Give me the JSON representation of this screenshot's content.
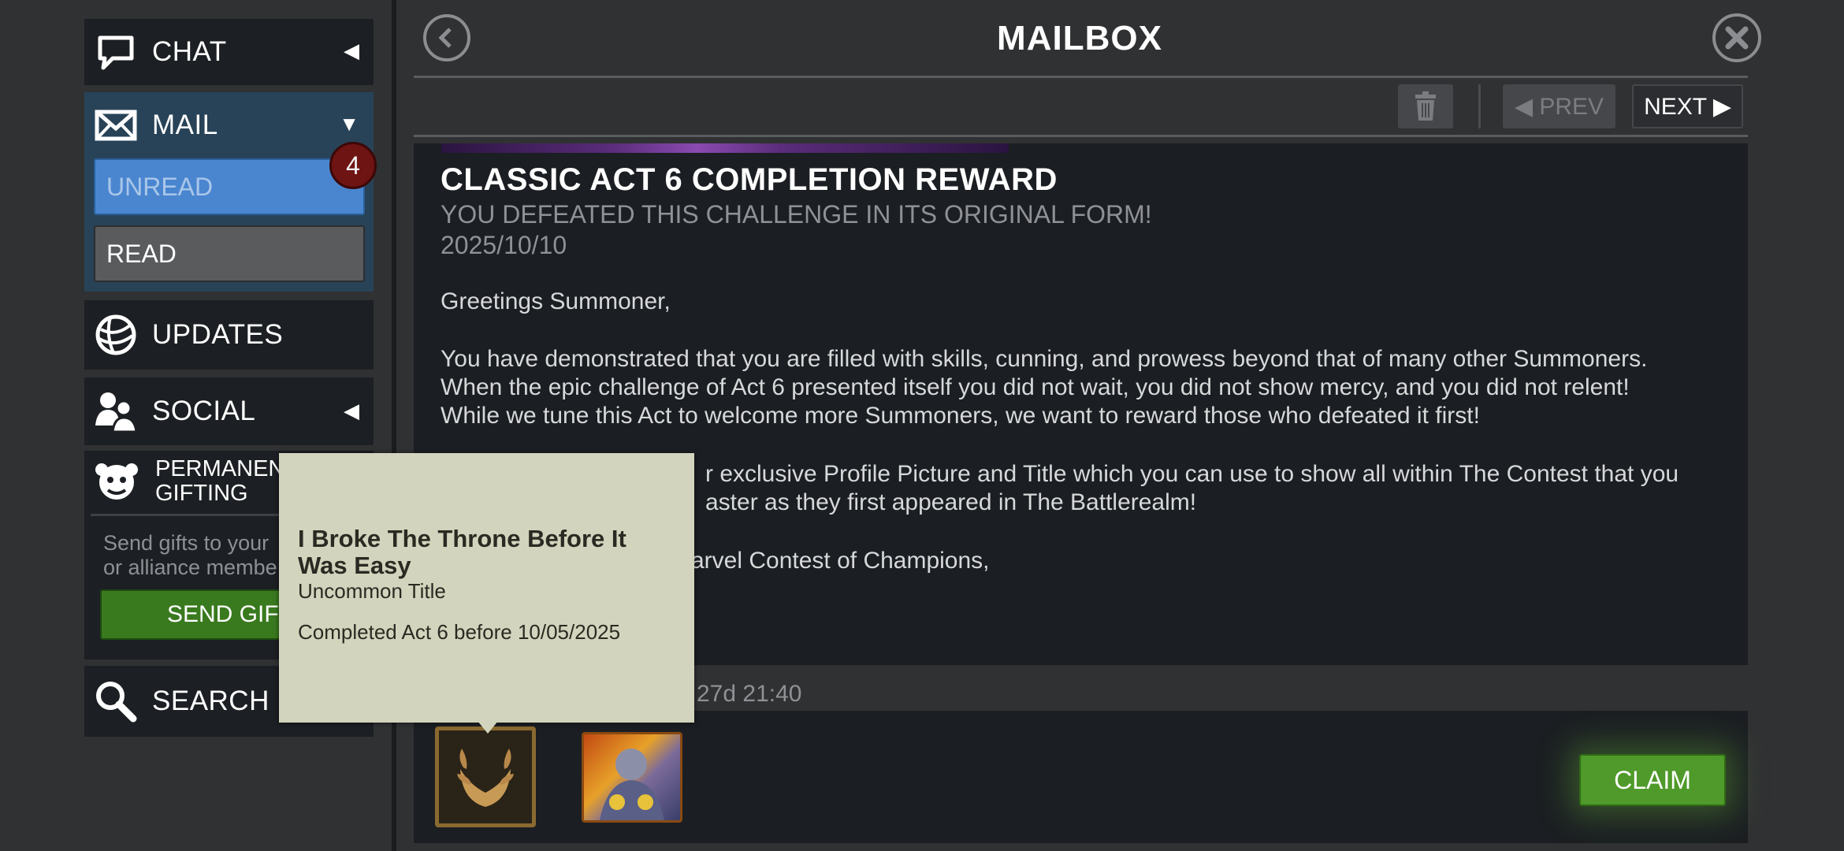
{
  "sidebar": {
    "chat": {
      "label": "CHAT",
      "arrow": "◀",
      "icon": "chat-bubble-icon"
    },
    "mail": {
      "label": "MAIL",
      "arrow": "▼",
      "icon": "envelope-icon"
    },
    "unread": {
      "label": "UNREAD",
      "badge": "4"
    },
    "read": {
      "label": "READ"
    },
    "updates": {
      "label": "UPDATES",
      "icon": "globe-icon"
    },
    "social": {
      "label": "SOCIAL",
      "arrow": "◀",
      "icon": "people-icon"
    },
    "gifting": {
      "title_line1": "PERMANENT",
      "title_line2": "GIFTING",
      "desc_line1": "Send gifts to your",
      "desc_line2": "or alliance membe",
      "button": "SEND GIFT",
      "icon": "gift-mascot-icon"
    },
    "search": {
      "label": "SEARCH",
      "icon": "magnifier-icon"
    }
  },
  "header": {
    "title": "MAILBOX",
    "back_icon": "back-arrow-icon",
    "close_icon": "close-x-icon"
  },
  "toolbar": {
    "prev": "◀ PREV",
    "next": "NEXT ▶",
    "delete_icon": "trash-icon"
  },
  "message": {
    "title": "CLASSIC ACT 6 COMPLETION REWARD",
    "subtitle": "YOU DEFEATED THIS CHALLENGE IN ITS ORIGINAL FORM!",
    "date": "2025/10/10",
    "greeting": "Greetings Summoner,",
    "para1_l1": "You have demonstrated that you are filled with skills, cunning, and prowess beyond that of many other Summoners.",
    "para1_l2": "When the epic challenge of Act 6 presented itself you did not wait, you did not show mercy, and you did not relent!",
    "para1_l3": "While we tune this Act to welcome more Summoners, we want to reward those who defeated it first!",
    "para2_l1": "r exclusive Profile Picture and Title which you can use to show all within The Contest that you",
    "para2_l2": "aster as they first appeared in The Battlerealm!",
    "signoff": "arvel Contest of Champions,",
    "expires": "27d 21:40"
  },
  "rewards": {
    "claim": "CLAIM"
  },
  "tooltip": {
    "title_l1": "I Broke The Throne Before It",
    "title_l2": "Was Easy",
    "type": "Uncommon Title",
    "desc": "Completed Act 6 before 10/05/2025"
  },
  "colors": {
    "unread": "#4a86cf",
    "badge": "#6e1412",
    "send_gift": "#3a7a1f",
    "claim": "#4f9a2a",
    "tooltip_bg": "#d3d4bd"
  }
}
